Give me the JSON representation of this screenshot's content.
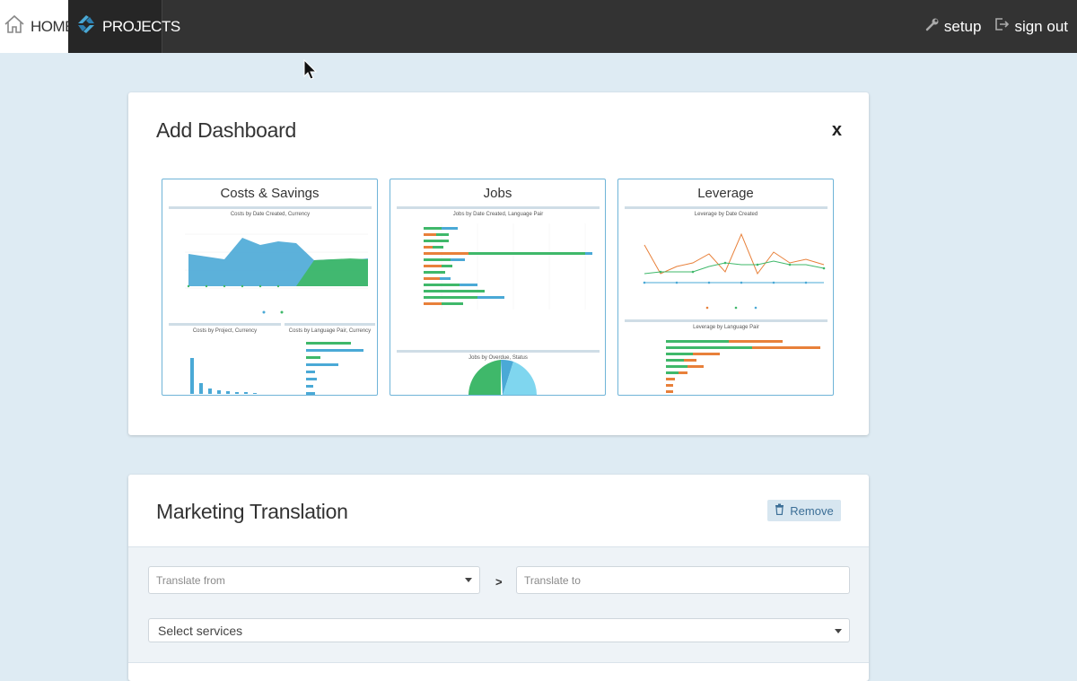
{
  "nav": {
    "home_label": "HOME",
    "projects_label": "PROJECTS",
    "setup_label": "setup",
    "signout_label": "sign out"
  },
  "add_dashboard": {
    "title": "Add Dashboard",
    "close_label": "x",
    "tiles": [
      {
        "title": "Costs & Savings",
        "panels": [
          "Costs by Date Created, Currency",
          "Costs by Project, Currency",
          "Costs by Language Pair, Currency"
        ]
      },
      {
        "title": "Jobs",
        "panels": [
          "Jobs by Date Created, Language Pair",
          "Jobs by Overdue, Status"
        ]
      },
      {
        "title": "Leverage",
        "panels": [
          "Leverage by Date Created",
          "Leverage by Language Pair"
        ]
      }
    ]
  },
  "project": {
    "title": "Marketing Translation",
    "remove_label": "Remove",
    "translate_from_placeholder": "Translate from",
    "separator": ">",
    "translate_to_placeholder": "Translate to",
    "services_placeholder": "Select services"
  },
  "colors": {
    "blue": "#4aa9d6",
    "green": "#3fb86a",
    "orange": "#e8803a",
    "topbar": "#333333"
  }
}
